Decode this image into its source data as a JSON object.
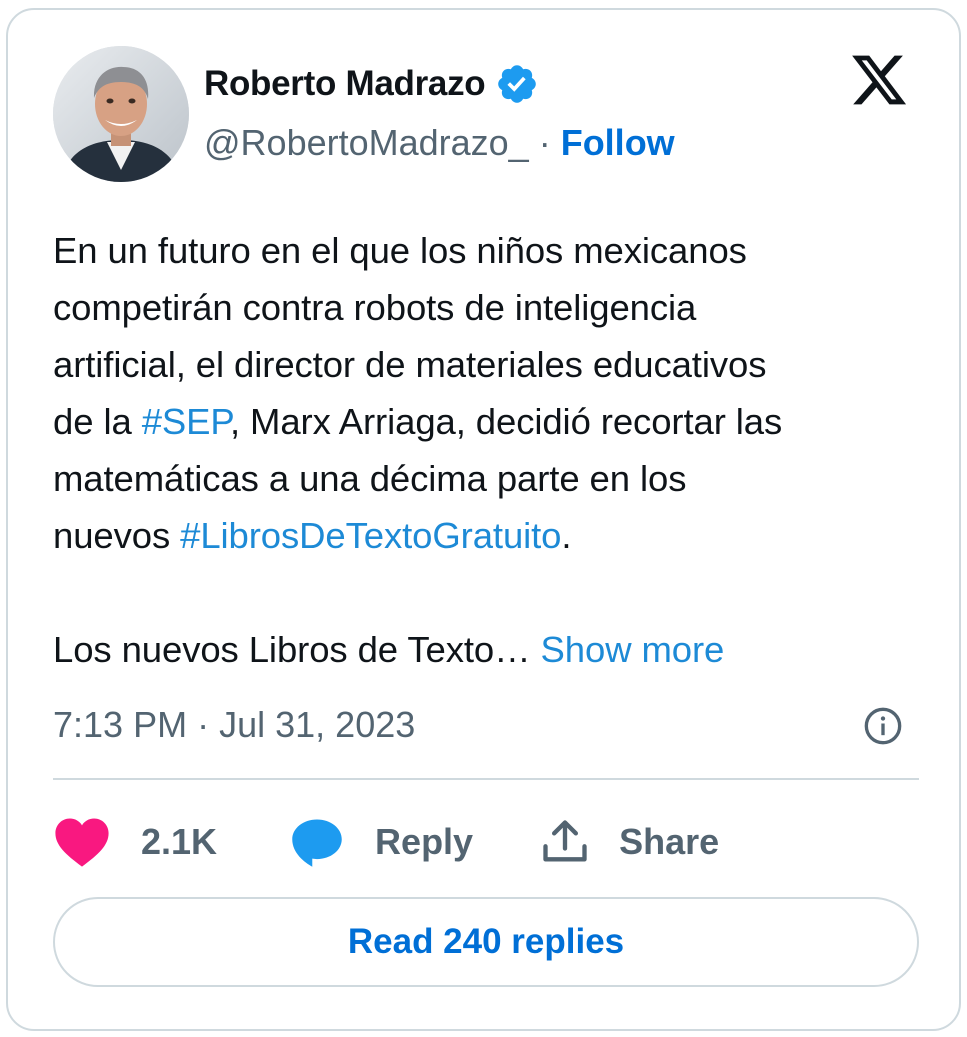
{
  "author": {
    "name": "Roberto Madrazo",
    "handle": "@RobertoMadrazo_",
    "separator": "·",
    "follow_label": "Follow",
    "verified_icon": "verified-badge-icon",
    "avatar": "profile-photo"
  },
  "platform_icon": "x-logo-icon",
  "tweet": {
    "lines": [
      [
        {
          "t": "En un futuro en el que los niños mexicanos"
        }
      ],
      [
        {
          "t": "competirán contra robots de inteligencia"
        }
      ],
      [
        {
          "t": "artificial, el director de materiales educativos"
        }
      ],
      [
        {
          "t": "de la "
        },
        {
          "t": "#SEP",
          "tag": true
        },
        {
          "t": ", Marx Arriaga, decidió recortar las"
        }
      ],
      [
        {
          "t": "matemáticas a una décima parte en los"
        }
      ],
      [
        {
          "t": "nuevos "
        },
        {
          "t": "#LibrosDeTextoGratuito",
          "tag": true
        },
        {
          "t": "."
        }
      ],
      [
        {
          "t": ""
        }
      ],
      [
        {
          "t": "Los nuevos Libros de Texto… "
        },
        {
          "t": "Show more",
          "more": true
        }
      ]
    ]
  },
  "meta": {
    "time": "7:13 PM",
    "separator": "·",
    "date": "Jul 31, 2023",
    "info_icon": "info-icon"
  },
  "actions": {
    "like_count": "2.1K",
    "reply_label": "Reply",
    "share_label": "Share"
  },
  "read_replies_label": "Read 240 replies",
  "colors": {
    "link": "#006fd6",
    "hashtag": "#1d8ad6",
    "heart": "#f91880",
    "reply_bubble": "#1d9bf0",
    "muted_text": "#536471",
    "border": "#cfd9de"
  }
}
